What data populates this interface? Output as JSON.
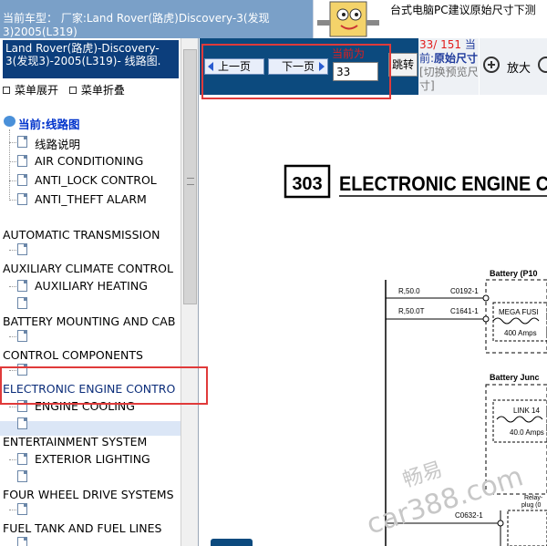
{
  "header": {
    "model_line": "当前车型：  厂家:Land Rover(路虎)Discovery-3(发现3)2005(L319)",
    "ad_text": "台式电脑PC建议原始尺寸下测"
  },
  "sidebar": {
    "car_title": "Land Rover(路虎)-Discovery-3(发现3)-2005(L319)- 线路图.",
    "expand_label": "菜单展开",
    "collapse_label": "菜单折叠",
    "root_label": "当前:线路图",
    "items": [
      {
        "label": "线路说明",
        "kind": "leaf"
      },
      {
        "label": "AIR CONDITIONING",
        "kind": "leaf"
      },
      {
        "label": "ANTI_LOCK CONTROL",
        "kind": "leaf"
      },
      {
        "label": "ANTI_THEFT ALARM",
        "kind": "leaf"
      },
      {
        "label": "AUTOMATIC TRANSMISSION",
        "kind": "group"
      },
      {
        "label": "AUXILIARY CLIMATE CONTROL",
        "kind": "group"
      },
      {
        "label": "AUXILIARY HEATING",
        "kind": "leaf"
      },
      {
        "label": "BATTERY MOUNTING AND CAB",
        "kind": "group"
      },
      {
        "label": "CONTROL COMPONENTS",
        "kind": "group"
      },
      {
        "label": "ELECTRONIC ENGINE CONTRO",
        "kind": "group",
        "selected": true
      },
      {
        "label": "ENGINE COOLING",
        "kind": "leaf"
      },
      {
        "label": "ENTERTAINMENT SYSTEM",
        "kind": "group"
      },
      {
        "label": "EXTERIOR LIGHTING",
        "kind": "leaf"
      },
      {
        "label": "FOUR WHEEL DRIVE SYSTEMS",
        "kind": "group"
      },
      {
        "label": "FUEL TANK AND FUEL LINES",
        "kind": "group"
      }
    ]
  },
  "toolbar": {
    "prev_label": "上一页",
    "next_label": "下一页",
    "current_label": "当前为",
    "page_value": "33",
    "jump_label": "跳转",
    "page_count_red": "33/ 151",
    "page_count_suffix": "当前:",
    "orig_size_label": "原始尺寸",
    "switch_preview_label": "[切换预览尺寸]",
    "zoom_in_label": "放大"
  },
  "document": {
    "section_number": "303",
    "section_title": "ELECTRONIC ENGINE C",
    "battery_label": "Battery (P10",
    "battery_junction_label": "Battery Junc",
    "wire_1_left": "R,50.0",
    "wire_1_right": "C0192-1",
    "wire_2_left": "R,50.0T",
    "wire_2_right": "C1641-1",
    "mega_fuse_label": "MEGA FUSI",
    "mega_fuse_rating": "400 Amps",
    "link_label": "LINK 14",
    "link_rating": "40.0 Amps",
    "relay_label": "Relay-",
    "plug_label": "plug (0",
    "connector_label": "C0632-1",
    "watermark_cn": "畅易",
    "watermark_url": "car388.com"
  },
  "colors": {
    "header_bg": "#7aa0c8",
    "title_bg": "#0c3e7c",
    "nav_bg": "#0c4a7e",
    "annotation_red": "#e03a3a",
    "accent_red": "#e21c1c",
    "accent_blue": "#1e3a9c"
  }
}
